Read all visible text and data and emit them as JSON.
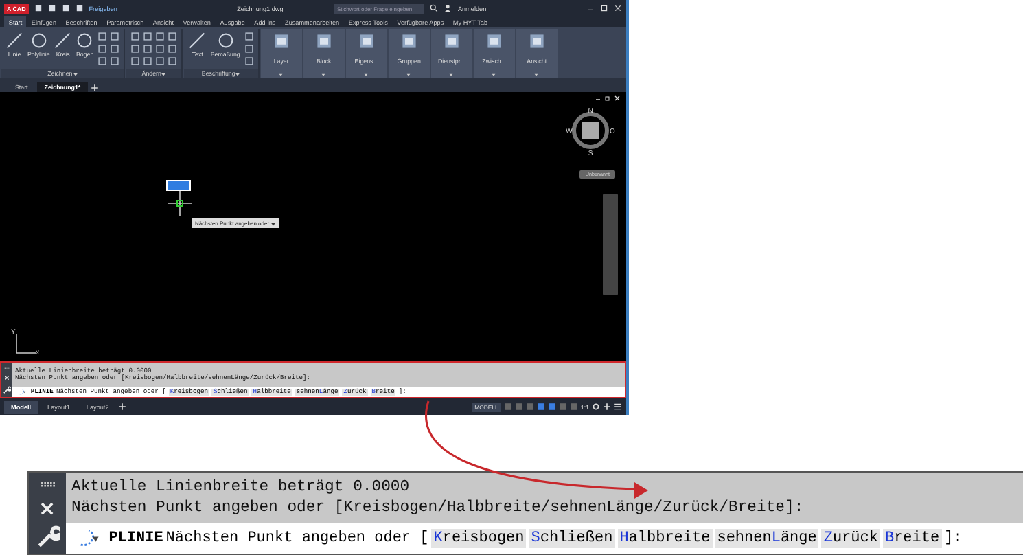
{
  "title_bar": {
    "logo": "A CAD",
    "share": "Freigeben",
    "title": "Zeichnung1.dwg",
    "search_placeholder": "Stichwort oder Frage eingeben",
    "sign_in": "Anmelden"
  },
  "ribbon_tabs": [
    {
      "label": "Start",
      "selected": true
    },
    {
      "label": "Einfügen",
      "selected": false
    },
    {
      "label": "Beschriften",
      "selected": false
    },
    {
      "label": "Parametrisch",
      "selected": false
    },
    {
      "label": "Ansicht",
      "selected": false
    },
    {
      "label": "Verwalten",
      "selected": false
    },
    {
      "label": "Ausgabe",
      "selected": false
    },
    {
      "label": "Add-ins",
      "selected": false
    },
    {
      "label": "Zusammenarbeiten",
      "selected": false
    },
    {
      "label": "Express Tools",
      "selected": false
    },
    {
      "label": "Verfügbare Apps",
      "selected": false
    },
    {
      "label": "My HYT Tab",
      "selected": false
    }
  ],
  "ribbon_panels": [
    {
      "kind": "tools",
      "title": "Zeichnen",
      "tools": [
        "Linie",
        "Polylinie",
        "Kreis",
        "Bogen"
      ]
    },
    {
      "kind": "tools",
      "title": "Ändern"
    },
    {
      "kind": "tools",
      "title": "Beschriftung",
      "tools": [
        "Text",
        "Bemaßung"
      ]
    },
    {
      "kind": "collapsed",
      "title": "Layer"
    },
    {
      "kind": "collapsed",
      "title": "Block"
    },
    {
      "kind": "collapsed",
      "title": "Eigens..."
    },
    {
      "kind": "collapsed",
      "title": "Gruppen"
    },
    {
      "kind": "collapsed",
      "title": "Dienstpr..."
    },
    {
      "kind": "collapsed",
      "title": "Zwisch..."
    },
    {
      "kind": "collapsed",
      "title": "Ansicht"
    }
  ],
  "doc_tabs": [
    {
      "label": "Start",
      "selected": false
    },
    {
      "label": "Zeichnung1*",
      "selected": true
    }
  ],
  "viewport": {
    "compass": {
      "north": "N",
      "east": "O",
      "south": "S",
      "west": "W"
    },
    "wcs_menu": "Unbenannt",
    "tooltip": "Nächsten Punkt angeben oder",
    "ucs_y": "Y",
    "ucs_x": "X"
  },
  "command_line": {
    "history": [
      "Aktuelle Linienbreite beträgt 0.0000",
      "Nächsten Punkt angeben oder [Kreisbogen/Halbbreite/sehnenLänge/Zurück/Breite]:"
    ],
    "command": "PLINIE",
    "prompt": "Nächsten Punkt angeben oder [",
    "options": [
      {
        "key": "K",
        "post": "reisbogen"
      },
      {
        "key": "S",
        "post": "chließen"
      },
      {
        "key": "H",
        "post": "albbreite"
      },
      {
        "pre": "sehnen",
        "key": "L",
        "post": "änge"
      },
      {
        "key": "Z",
        "post": "urück"
      },
      {
        "key": "B",
        "post": "reite"
      }
    ],
    "end": "]:"
  },
  "layout_tabs": [
    {
      "label": "Modell",
      "selected": true
    },
    {
      "label": "Layout1",
      "selected": false
    },
    {
      "label": "Layout2",
      "selected": false
    }
  ],
  "status_bar": {
    "space": "MODELL",
    "scale": "1:1"
  },
  "command_line_magnified": {
    "history": [
      "Aktuelle Linienbreite beträgt 0.0000",
      "Nächsten Punkt angeben oder [Kreisbogen/Halbbreite/sehnenLänge/Zurück/Breite]:"
    ],
    "command": "PLINIE",
    "prompt": "Nächsten Punkt angeben oder [",
    "options": [
      {
        "key": "K",
        "post": "reisbogen"
      },
      {
        "key": "S",
        "post": "chließen"
      },
      {
        "key": "H",
        "post": "albbreite"
      },
      {
        "pre": "sehnen",
        "key": "L",
        "post": "änge"
      },
      {
        "key": "Z",
        "post": "urück"
      },
      {
        "key": "B",
        "post": "reite"
      }
    ],
    "end": "]:"
  }
}
